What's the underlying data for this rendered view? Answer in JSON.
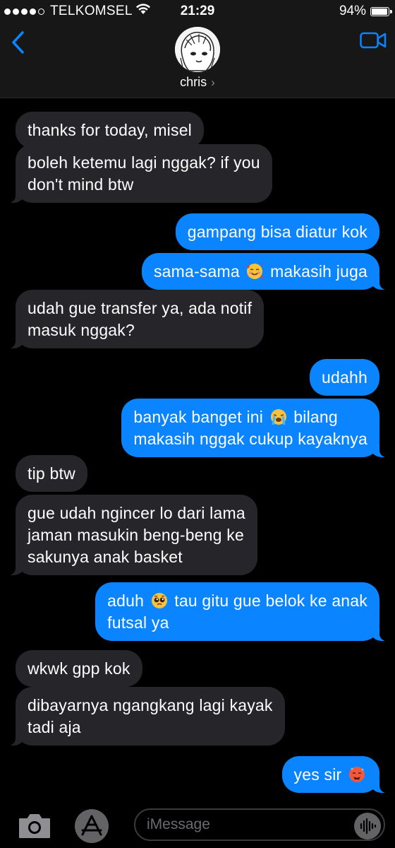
{
  "status_bar": {
    "signal_filled": 4,
    "signal_total": 5,
    "carrier": "TELKOMSEL",
    "time": "21:29",
    "battery_text": "94%",
    "battery_level": 0.94,
    "wifi_icon": "wifi-icon"
  },
  "header": {
    "contact_name": "chris",
    "chevron": "›",
    "back_icon": "chevron-left-icon",
    "video_icon": "video-camera-icon"
  },
  "colors": {
    "incoming_bubble": "#26252a",
    "outgoing_bubble": "#0b84ff",
    "accent": "#0b84ff"
  },
  "messages": [
    {
      "dir": "in",
      "text": "thanks for today, misel"
    },
    {
      "dir": "in",
      "text": "boleh ketemu lagi nggak? if you\ndon't mind btw"
    },
    {
      "dir": "out",
      "text": "gampang bisa diatur kok"
    },
    {
      "dir": "out",
      "text_before": "sama-sama ",
      "emoji": "smiling-face-with-hearts",
      "text_after": " makasih juga"
    },
    {
      "dir": "in",
      "text": "udah gue transfer ya, ada notif\nmasuk nggak?"
    },
    {
      "dir": "out",
      "text": "udahh"
    },
    {
      "dir": "out",
      "text_before": "banyak banget ini ",
      "emoji": "loudly-crying-face",
      "text_after": " bilang\nmakasih nggak cukup kayaknya"
    },
    {
      "dir": "in",
      "text": "tip btw"
    },
    {
      "dir": "in",
      "text": "gue udah ngincer lo dari lama\njaman masukin beng-beng ke\nsakunya anak basket"
    },
    {
      "dir": "out",
      "text_before": "aduh ",
      "emoji": "pleading-face",
      "text_after": " tau gitu gue belok ke anak\nfutsal ya"
    },
    {
      "dir": "in",
      "text": "wkwk gpp kok"
    },
    {
      "dir": "in",
      "text": "dibayarnya ngangkang lagi kayak\ntadi aja"
    },
    {
      "dir": "out",
      "text_before": "yes sir ",
      "emoji": "hot-face",
      "text_after": ""
    }
  ],
  "bottom_bar": {
    "camera_icon": "camera-icon",
    "apps_icon": "app-store-icon",
    "input_placeholder": "iMessage",
    "input_value": "",
    "audio_icon": "audio-waveform-icon"
  }
}
